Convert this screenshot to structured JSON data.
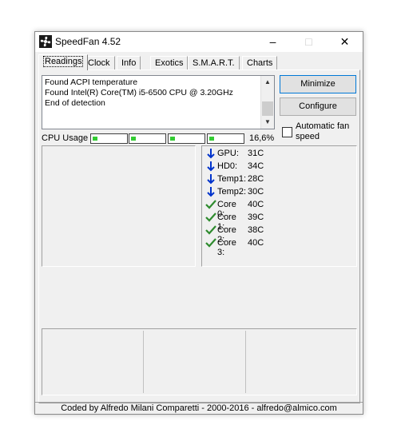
{
  "window": {
    "title": "SpeedFan 4.52",
    "controls": {
      "minimize": "–",
      "maximize": "□",
      "close": "✕"
    }
  },
  "tabs": [
    "Readings",
    "Clock",
    "Info",
    "Exotics",
    "S.M.A.R.T.",
    "Charts"
  ],
  "active_tab": "Readings",
  "log": {
    "lines": [
      "Found ACPI temperature",
      "Found Intel(R) Core(TM) i5-6500 CPU @ 3.20GHz",
      "End of detection"
    ]
  },
  "buttons": {
    "minimize": "Minimize",
    "configure": "Configure"
  },
  "auto_fan": {
    "label": "Automatic fan speed",
    "checked": false
  },
  "cpu": {
    "label": "CPU Usage",
    "percent": "16,6%",
    "core_count": 4
  },
  "sensors": [
    {
      "name": "GPU:",
      "value": "31C",
      "status": "down-arrow-icon"
    },
    {
      "name": "HD0:",
      "value": "34C",
      "status": "down-arrow-icon"
    },
    {
      "name": "Temp1:",
      "value": "28C",
      "status": "down-arrow-icon"
    },
    {
      "name": "Temp2:",
      "value": "30C",
      "status": "down-arrow-icon"
    },
    {
      "name": "Core 0:",
      "value": "40C",
      "status": "check-icon"
    },
    {
      "name": "Core 1:",
      "value": "39C",
      "status": "check-icon"
    },
    {
      "name": "Core 2:",
      "value": "38C",
      "status": "check-icon"
    },
    {
      "name": "Core 3:",
      "value": "40C",
      "status": "check-icon"
    }
  ],
  "colors": {
    "arrow": "#0033cc",
    "check": "#2e8b2e",
    "cpu_led": "#33cc33"
  },
  "status_bar": "Coded by Alfredo Milani Comparetti - 2000-2016 - alfredo@almico.com"
}
